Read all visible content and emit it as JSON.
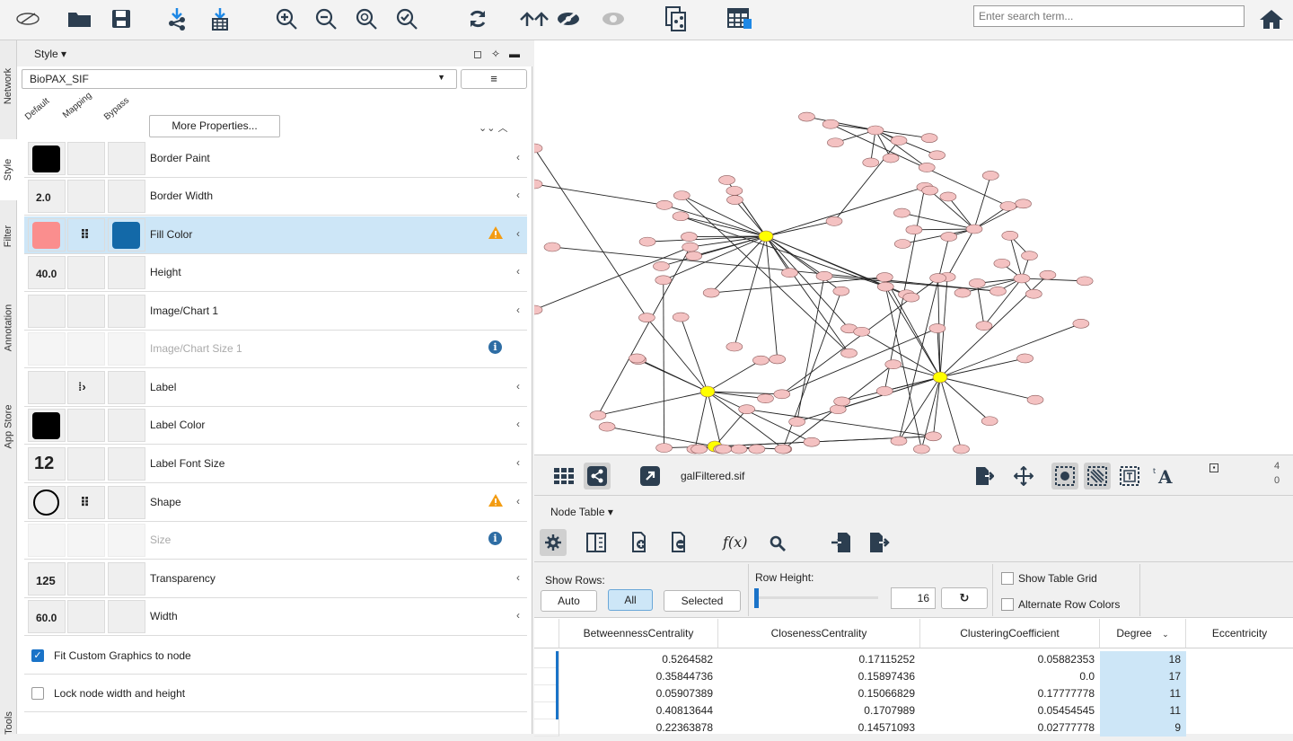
{
  "toolbar": {
    "search_placeholder": "Enter search term..."
  },
  "vtabs": [
    "Network",
    "Style",
    "Filter",
    "Annotation",
    "App Store",
    "Tools"
  ],
  "style_panel": {
    "title": "Style",
    "style_name": "BioPAX_SIF",
    "col_headers": [
      "Default",
      "Mapping",
      "Bypass"
    ],
    "more_properties": "More Properties...",
    "properties": [
      {
        "name": "Border Paint",
        "default": "",
        "swatch": "#000000",
        "mapping": "",
        "bypass": "",
        "enabled": true
      },
      {
        "name": "Border Width",
        "default": "2.0",
        "enabled": true
      },
      {
        "name": "Fill Color",
        "swatch": "#fa8e8e",
        "mapping": "continuous",
        "bypass_color": "#1369a8",
        "warn": true,
        "selected": true,
        "enabled": true
      },
      {
        "name": "Height",
        "default": "40.0",
        "enabled": true
      },
      {
        "name": "Image/Chart 1",
        "default": "",
        "enabled": true
      },
      {
        "name": "Image/Chart Size 1",
        "default": "",
        "enabled": false,
        "info": true
      },
      {
        "name": "Label",
        "default": "",
        "mapping": "passthrough",
        "enabled": true
      },
      {
        "name": "Label Color",
        "swatch": "#000000",
        "enabled": true
      },
      {
        "name": "Label Font Size",
        "default": "12",
        "enabled": true
      },
      {
        "name": "Shape",
        "shape": "ellipse",
        "mapping": "continuous",
        "warn": true,
        "enabled": true
      },
      {
        "name": "Size",
        "default": "",
        "enabled": false,
        "info": true
      },
      {
        "name": "Transparency",
        "default": "125",
        "enabled": true
      },
      {
        "name": "Width",
        "default": "60.0",
        "enabled": true
      }
    ],
    "checkboxes": [
      {
        "label": "Fit Custom Graphics to node",
        "checked": true
      },
      {
        "label": "Lock node width and height",
        "checked": false
      }
    ]
  },
  "network": {
    "name": "galFiltered.sif",
    "counts": [
      "4",
      "0"
    ]
  },
  "node_table": {
    "title": "Node Table",
    "show_rows_label": "Show Rows:",
    "row_buttons": [
      "Auto",
      "All",
      "Selected"
    ],
    "row_height_label": "Row Height:",
    "row_height_value": "16",
    "show_grid": "Show Table Grid",
    "alt_colors": "Alternate Row Colors",
    "columns": [
      "BetweennessCentrality",
      "ClosenessCentrality",
      "ClusteringCoefficient",
      "Degree",
      "Eccentricity"
    ],
    "rows": [
      [
        "0.5264582",
        "0.17115252",
        "0.05882353",
        "18"
      ],
      [
        "0.35844736",
        "0.15897436",
        "0.0",
        "17"
      ],
      [
        "0.05907389",
        "0.15066829",
        "0.17777778",
        "11"
      ],
      [
        "0.40813644",
        "0.1707989",
        "0.05454545",
        "11"
      ],
      [
        "0.22363878",
        "0.14571093",
        "0.02777778",
        "9"
      ]
    ]
  },
  "colors": {
    "selected_bg": "#cde6f7",
    "node_fill": "#f4c2c2",
    "hub_fill": "#ffff00"
  }
}
